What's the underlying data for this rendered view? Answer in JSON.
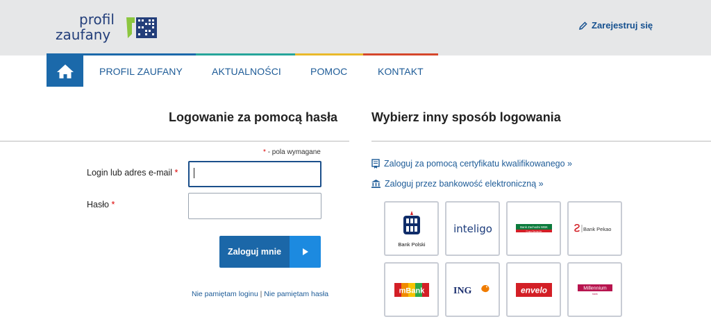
{
  "header": {
    "logo_line1": "profil",
    "logo_line2": "zaufany",
    "register_label": "Zarejestruj się"
  },
  "nav": {
    "items": [
      {
        "label": "PROFIL ZAUFANY"
      },
      {
        "label": "AKTUALNOŚCI"
      },
      {
        "label": "POMOC"
      },
      {
        "label": "KONTAKT"
      }
    ],
    "stripe_colors": [
      "#1b69aa",
      "#26a59a",
      "#e9b92a",
      "#d5462b"
    ]
  },
  "login": {
    "title": "Logowanie za pomocą hasła",
    "required_note": "- pola wymagane",
    "required_mark": "*",
    "login_label": "Login lub adres e-mail",
    "login_value": "",
    "password_label": "Hasło",
    "password_value": "",
    "submit_label": "Zaloguj mnie",
    "forgot_login": "Nie pamiętam loginu",
    "separator": "|",
    "forgot_password": "Nie pamiętam hasła"
  },
  "alternative": {
    "title": "Wybierz inny sposób logowania",
    "certificate_link": "Zaloguj za pomocą certyfikatu kwalifikowanego »",
    "bank_link": "Zaloguj przez bankowość elektroniczną »",
    "banks": [
      {
        "name": "Bank Polski",
        "icon": "pko-bp-logo"
      },
      {
        "name": "inteligo",
        "icon": "inteligo-logo"
      },
      {
        "name": "Bank Zachodni WBK",
        "sub": "Grupa Santander",
        "icon": "bzwbk-logo"
      },
      {
        "name": "Bank Pekao",
        "icon": "pekao-logo"
      },
      {
        "name": "mBank",
        "icon": "mbank-logo"
      },
      {
        "name": "ING",
        "icon": "ing-logo"
      },
      {
        "name": "envelo",
        "icon": "envelo-logo"
      },
      {
        "name": "Millennium",
        "sub": "bank",
        "icon": "millennium-logo"
      }
    ]
  },
  "colors": {
    "primary": "#1b67a8",
    "accent": "#1c8ae0",
    "link": "#1d5b97",
    "header_bg": "#e6e7e8"
  }
}
